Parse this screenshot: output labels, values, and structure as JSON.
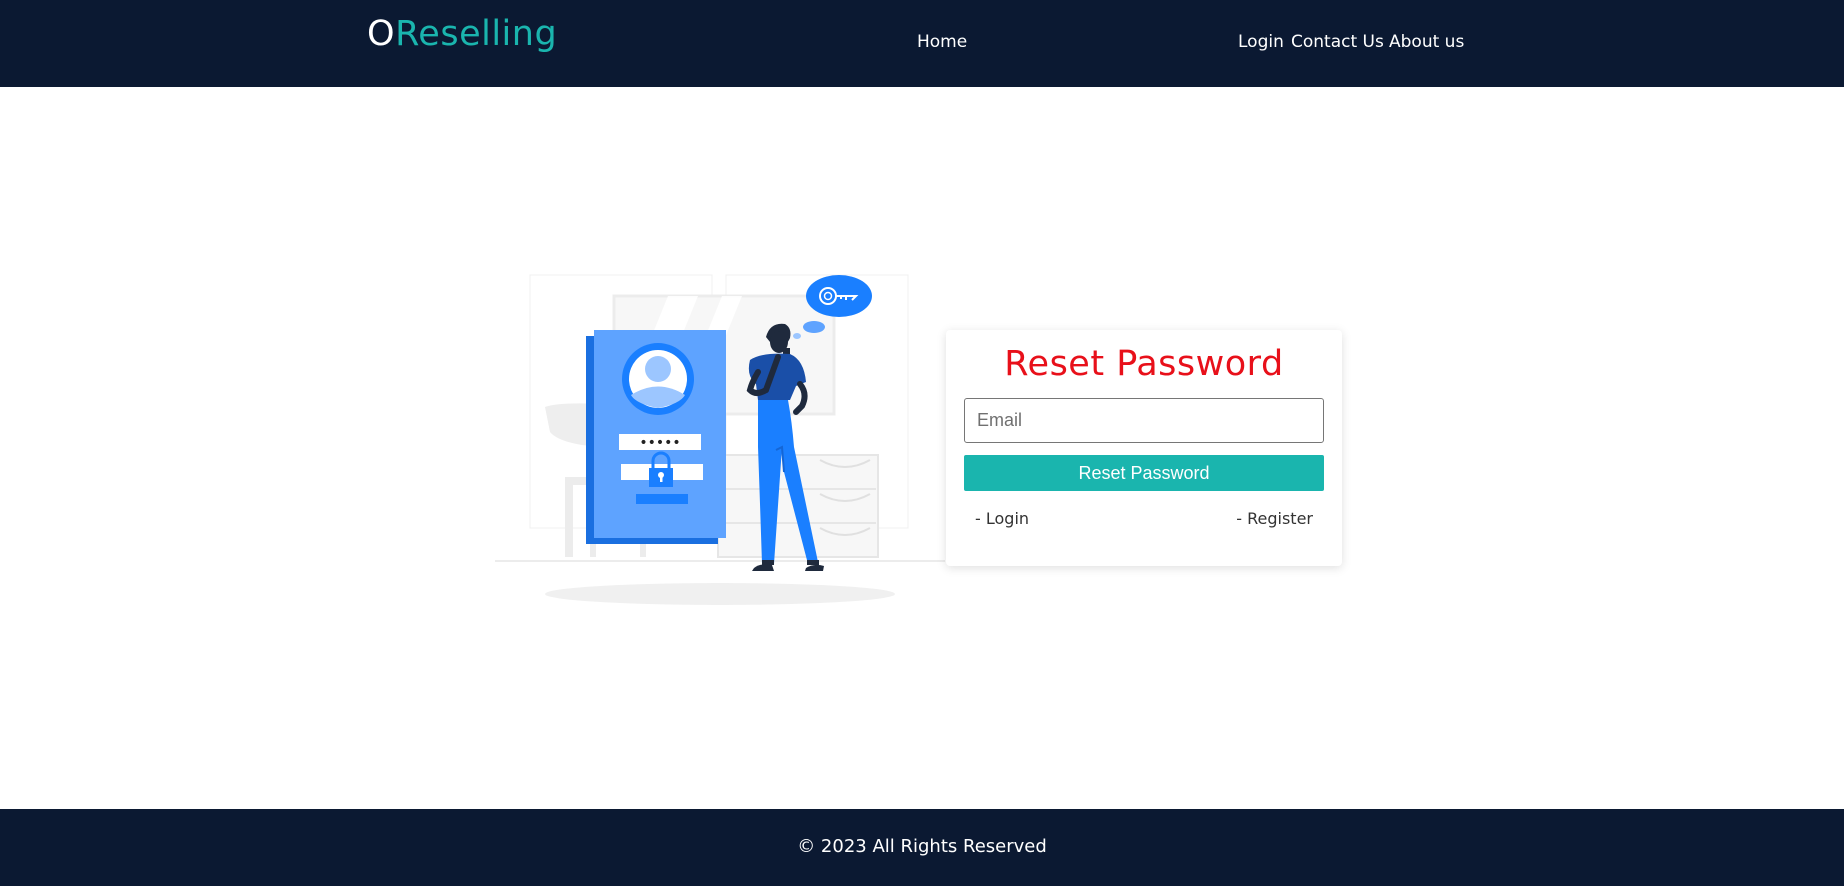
{
  "brand": {
    "first_letter": "O",
    "rest": "Reselling"
  },
  "nav": {
    "home": "Home",
    "login": "Login",
    "contact": "Contact Us",
    "about": "About us"
  },
  "reset_card": {
    "title": "Reset Password",
    "email_placeholder": "Email",
    "email_value": "",
    "button_label": "Reset Password",
    "login_link": "- Login",
    "register_link": "- Register"
  },
  "footer": {
    "copyright": "© 2023 All Rights Reserved"
  },
  "colors": {
    "navbar_bg": "#0b1932",
    "accent": "#1ab5ae",
    "title_red": "#e8101a",
    "illustration_blue": "#1a7fff"
  },
  "illustration": {
    "password_mask": "•••••"
  }
}
